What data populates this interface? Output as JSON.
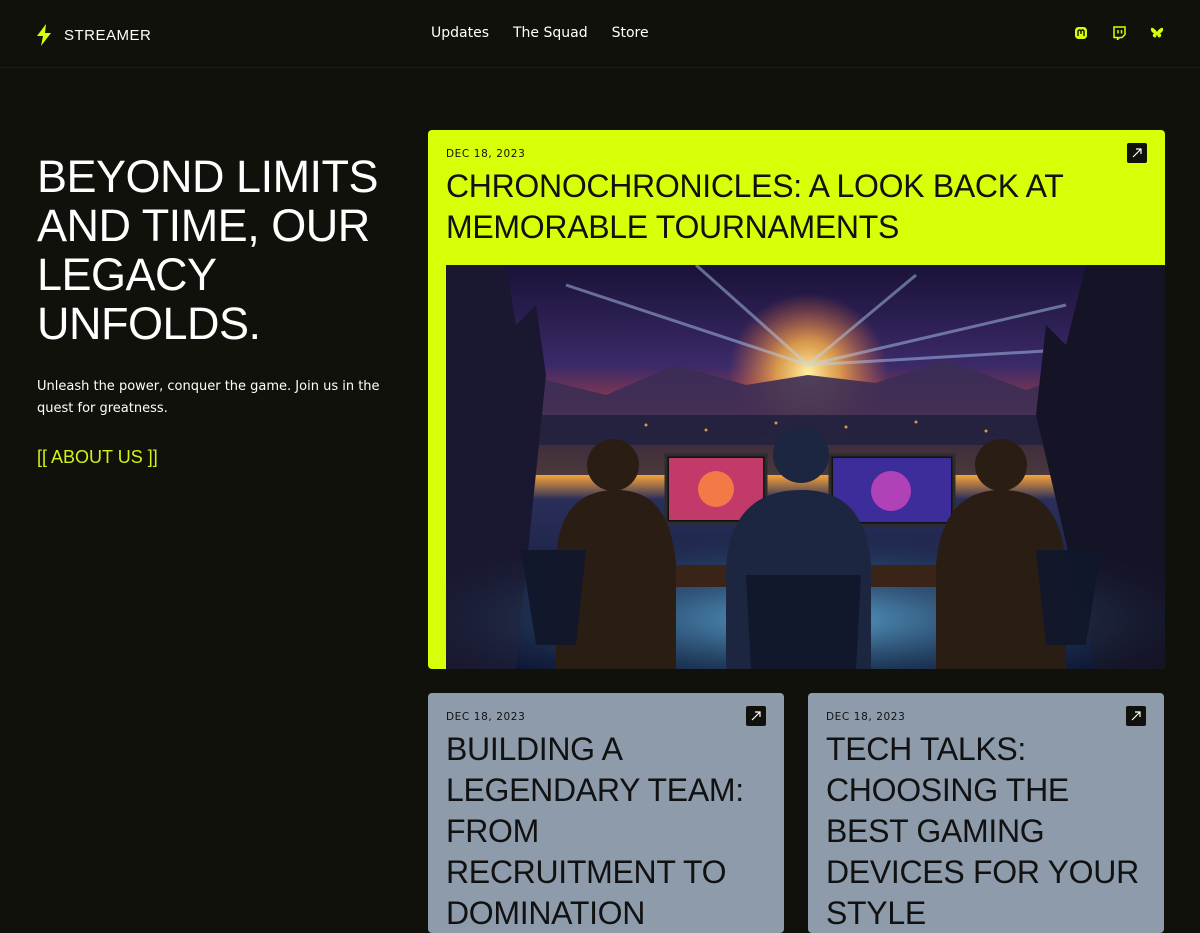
{
  "brand": {
    "name": "STREAMER",
    "accent": "#d6ff08"
  },
  "nav": {
    "items": [
      "Updates",
      "The Squad",
      "Store"
    ]
  },
  "socials": [
    "mastodon-icon",
    "twitch-icon",
    "bluesky-icon"
  ],
  "hero": {
    "title": "BEYOND LIMITS AND TIME, OUR LEGACY UNFOLDS.",
    "text": "Unleash the power, conquer the game. Join us in the quest for greatness.",
    "link": "[[ ABOUT US ]]"
  },
  "cards": {
    "feature": {
      "date": "DEC 18, 2023",
      "title": "CHRONOCHRONICLES: A LOOK BACK AT MEMORABLE TOURNAMENTS",
      "color": "#d6ff08"
    },
    "small": [
      {
        "date": "DEC 18, 2023",
        "title": "BUILDING A LEGENDARY TEAM: FROM RECRUITMENT TO DOMINATION",
        "color": "#8d9bab"
      },
      {
        "date": "DEC 18, 2023",
        "title": "TECH TALKS: CHOOSING THE BEST GAMING DEVICES FOR YOUR STYLE",
        "color": "#8d9bab"
      }
    ]
  }
}
